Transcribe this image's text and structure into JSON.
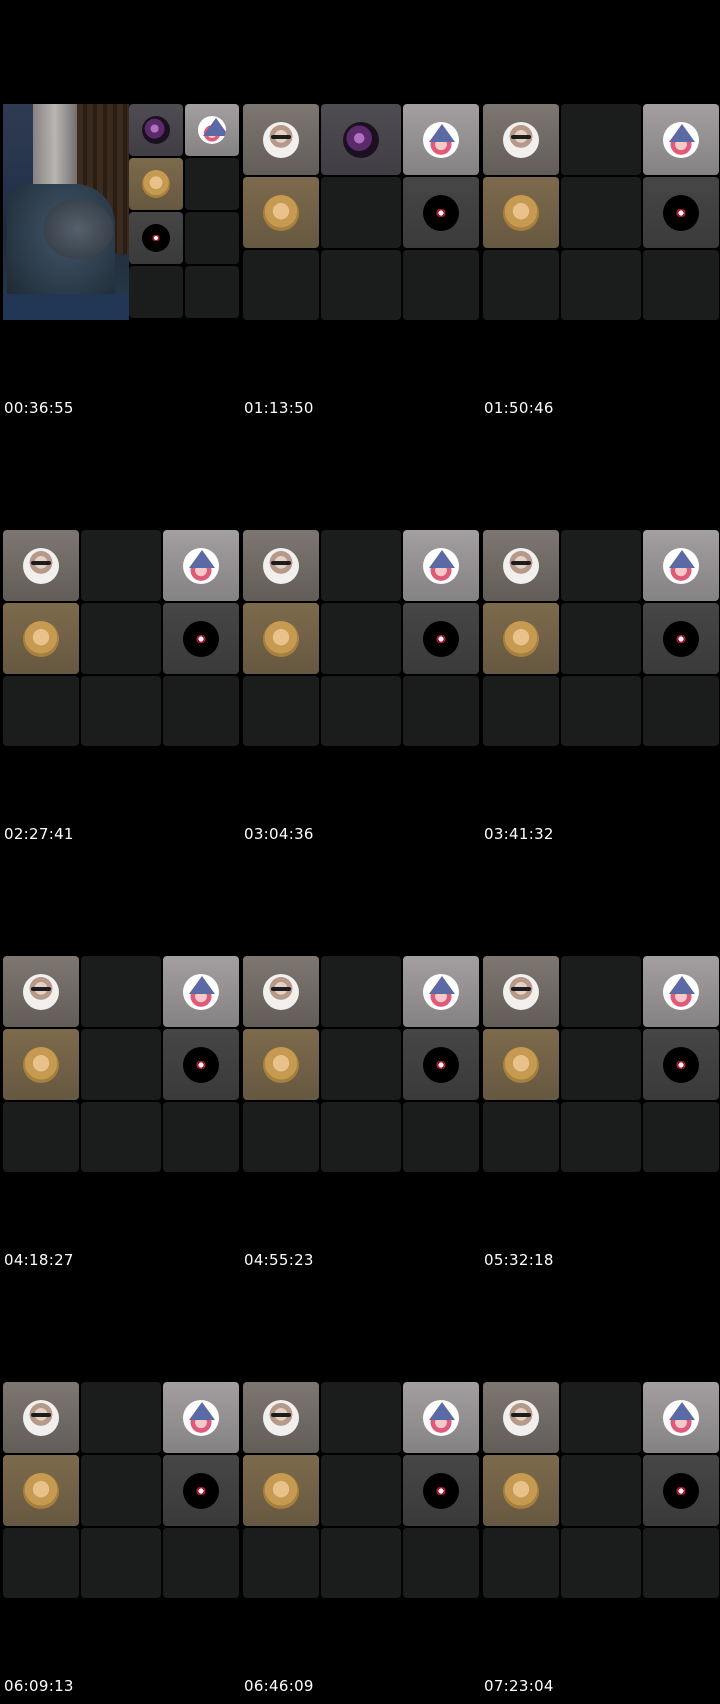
{
  "sheet": {
    "title": "",
    "frames": [
      {
        "timestamp": "00:36:55",
        "layout": "first"
      },
      {
        "timestamp": "01:13:50",
        "layout": "second"
      },
      {
        "timestamp": "01:50:46",
        "layout": "standard"
      },
      {
        "timestamp": "02:27:41",
        "layout": "standard"
      },
      {
        "timestamp": "03:04:36",
        "layout": "standard"
      },
      {
        "timestamp": "03:41:32",
        "layout": "standard"
      },
      {
        "timestamp": "04:18:27",
        "layout": "standard"
      },
      {
        "timestamp": "04:55:23",
        "layout": "standard"
      },
      {
        "timestamp": "05:32:18",
        "layout": "standard"
      },
      {
        "timestamp": "06:09:13",
        "layout": "standard"
      },
      {
        "timestamp": "06:46:09",
        "layout": "standard"
      },
      {
        "timestamp": "07:23:04",
        "layout": "standard"
      }
    ]
  },
  "participants": {
    "man": {
      "icon": "man-with-sunglasses-avatar"
    },
    "girl": {
      "icon": "witch-girl-avatar"
    },
    "gold": {
      "icon": "golden-portrait-avatar"
    },
    "logo": {
      "icon": "black-logo-avatar"
    },
    "venom": {
      "icon": "purple-venom-avatar"
    }
  },
  "colors": {
    "background": "#000000",
    "empty_tile": "#1b1c1c",
    "timestamp_text": "#ffffff"
  }
}
